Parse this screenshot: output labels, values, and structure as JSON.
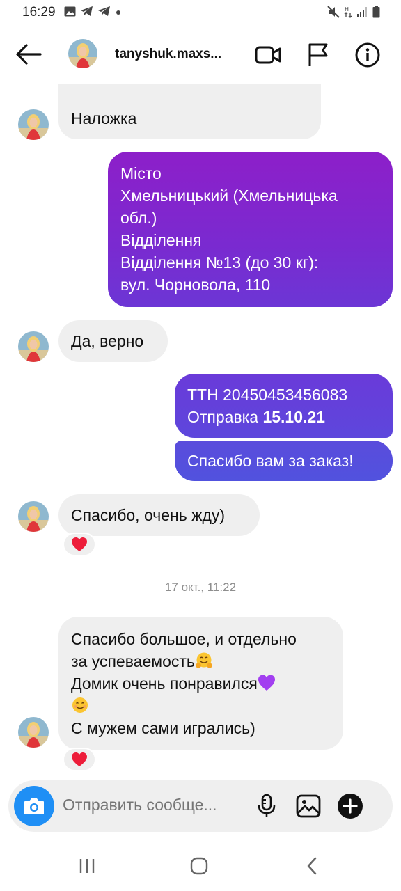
{
  "status": {
    "time": "16:29",
    "left_icons": [
      "gallery-icon",
      "telegram-icon",
      "telegram-icon",
      "dot-icon"
    ],
    "right_icons": [
      "mute-icon",
      "data-arrows-icon",
      "signal-icon",
      "battery-icon"
    ]
  },
  "header": {
    "username": "tanyshuk.maxs...",
    "icons": [
      "back-arrow-icon",
      "video-call-icon",
      "flag-icon",
      "info-icon"
    ]
  },
  "messages": [
    {
      "side": "in",
      "text": "Наложка"
    },
    {
      "side": "out",
      "lines": [
        "Місто",
        "Хмельницький (Хмельницька",
        "обл.)",
        "Відділення",
        "Відділення №13 (до 30 кг):",
        "вул. Чорновола, 110"
      ]
    },
    {
      "side": "in",
      "text": "Да, верно"
    },
    {
      "side": "out",
      "lines": [
        "ТТН 20450453456083"
      ],
      "prefix": "Отправка ",
      "bold": "15.10.21"
    },
    {
      "side": "out",
      "text": "Спасибо вам за заказ!"
    },
    {
      "side": "in",
      "text": "Спасибо, очень жду)",
      "reaction": "heart-icon"
    },
    {
      "side": "in",
      "lines": [
        "Спасибо большое, и отдельно",
        "за успеваемость",
        "Домик очень понравился",
        "",
        "С мужем сами игрались)"
      ],
      "reaction": "heart-icon"
    }
  ],
  "timestamp": "17 окт., 11:22",
  "composer": {
    "placeholder": "Отправить сообще...",
    "icons": [
      "camera-icon",
      "microphone-icon",
      "gallery-icon",
      "add-icon"
    ]
  },
  "colors": {
    "incoming_bubble": "#efefef",
    "outgoing_top": "#8d1fc9",
    "outgoing_bottom": "#5b4bdc",
    "camera_button": "#1f8ff5",
    "heart": "#ed1d3a"
  },
  "navbar": [
    "recent-apps-icon",
    "home-icon",
    "back-icon"
  ]
}
